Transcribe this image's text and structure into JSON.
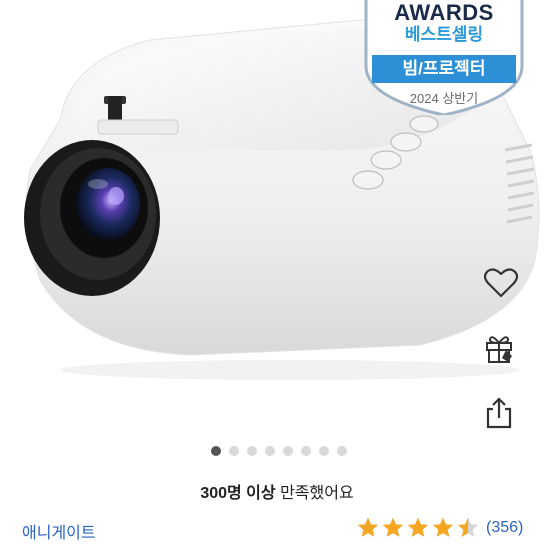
{
  "badge": {
    "title": "AWARDS",
    "subtitle": "베스트셀링",
    "category": "빔/프로젝터",
    "period": "2024 상반기"
  },
  "side_actions": [
    {
      "icon": "heart-icon"
    },
    {
      "icon": "gift-icon"
    },
    {
      "icon": "share-icon"
    }
  ],
  "gallery": {
    "total_images": 8,
    "active_index": 0
  },
  "satisfaction": {
    "bold": "300명 이상",
    "rest": " 만족했어요"
  },
  "seller": "애니게이트",
  "rating": {
    "stars": 4.5,
    "max": 5,
    "count_text": "(356)",
    "star_color": "#f5a623"
  },
  "colors": {
    "accent_blue": "#2d8fd5",
    "link_blue": "#2a63c7"
  }
}
